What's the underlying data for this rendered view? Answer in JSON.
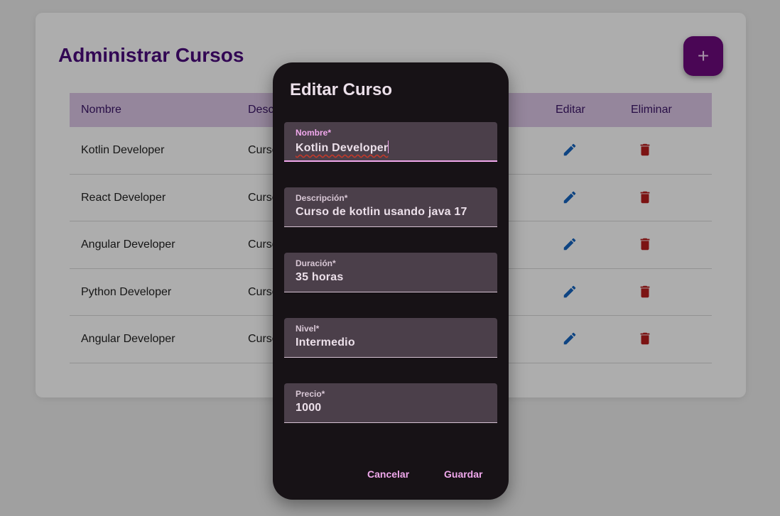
{
  "page": {
    "title": "Administrar Cursos",
    "add_icon": "+"
  },
  "table": {
    "headers": {
      "nombre": "Nombre",
      "descripcion": "Desc",
      "editar": "Editar",
      "eliminar": "Eliminar"
    },
    "rows": [
      {
        "nombre": "Kotlin Developer",
        "descripcion": "Curso"
      },
      {
        "nombre": "React Developer",
        "descripcion": "Curso"
      },
      {
        "nombre": "Angular Developer",
        "descripcion": "Curso"
      },
      {
        "nombre": "Python Developer",
        "descripcion": "Curso"
      },
      {
        "nombre": "Angular Developer",
        "descripcion": "Curso"
      }
    ]
  },
  "dialog": {
    "title": "Editar Curso",
    "fields": [
      {
        "label": "Nombre*",
        "value": "Kotlin Developer"
      },
      {
        "label": "Descripción*",
        "value": "Curso de kotlin usando java 17"
      },
      {
        "label": "Duración*",
        "value": "35 horas"
      },
      {
        "label": "Nivel*",
        "value": "Intermedio"
      },
      {
        "label": "Precio*",
        "value": "1000"
      }
    ],
    "cancel_label": "Cancelar",
    "save_label": "Guardar"
  },
  "colors": {
    "title": "#4a0b7c",
    "fab": "#6d0a7e",
    "header_row": "#dcc6e6",
    "edit_icon": "#1565c0",
    "delete_icon": "#b71c1c",
    "dialog_bg": "#171216",
    "field_bg": "#4b3f4a",
    "accent": "#f0a8ec"
  },
  "icons": {
    "edit": "pencil-icon",
    "delete": "trash-icon"
  }
}
